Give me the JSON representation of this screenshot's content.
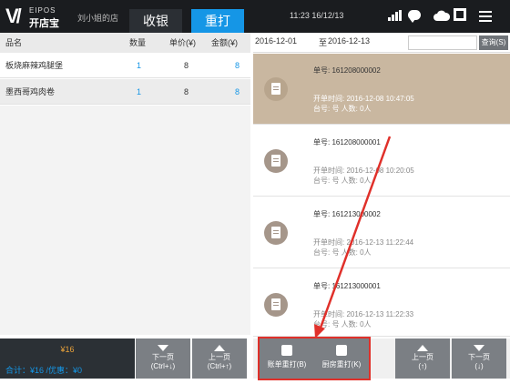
{
  "header": {
    "brand_top": "EIPOS",
    "brand_bottom": "开店宝",
    "shop_name": "刘小姐的店",
    "tabs": [
      {
        "label": "收银"
      },
      {
        "label": "重打"
      }
    ],
    "status_text": "11:23  16/12/13"
  },
  "order_table": {
    "columns": [
      "品名",
      "数量",
      "单价(¥)",
      "金额(¥)"
    ],
    "rows": [
      {
        "name": "板烧麻辣鸡腿堡",
        "qty": "1",
        "price": "8",
        "amount": "8"
      },
      {
        "name": "墨西哥鸡肉卷",
        "qty": "1",
        "price": "8",
        "amount": "8"
      }
    ]
  },
  "totals": {
    "amount": "¥16",
    "line": "合计：¥16   /优惠：¥0"
  },
  "left_pager": {
    "next_label": "下一页",
    "next_shortcut": "(Ctrl+↓)",
    "prev_label": "上一页",
    "prev_shortcut": "(Ctrl+↑)"
  },
  "search": {
    "start_date": "2016-12-01",
    "separator": "至",
    "end_date": "2016-12-13",
    "query_label": "查询(S)"
  },
  "orders": [
    {
      "number": "单号: 161208000002",
      "open_time": "开单时间: 2016-12-08  10:47:05",
      "table": "台号: 号  人数: 0人",
      "selected": true
    },
    {
      "number": "单号: 161208000001",
      "open_time": "开单时间: 2016-12-08  10:20:05",
      "table": "台号: 号  人数: 0人",
      "selected": false
    },
    {
      "number": "单号: 161213000002",
      "open_time": "开单时间: 2016-12-13  11:22:44",
      "table": "台号: 号  人数: 0人",
      "selected": false
    },
    {
      "number": "单号: 161213000001",
      "open_time": "开单时间: 2016-12-13  11:22:33",
      "table": "台号: 号  人数: 0人",
      "selected": false
    }
  ],
  "actions": {
    "bill_reprint": "账单重打(B)",
    "kitchen_reprint": "厨房重打(K)"
  },
  "right_pager": {
    "prev_label": "上一页",
    "prev_shortcut": "(↑)",
    "next_label": "下一页",
    "next_shortcut": "(↓)"
  },
  "colors": {
    "accent": "#1596e6",
    "selected_card": "#c9b7a0",
    "highlight": "#e0302a",
    "total_amount": "#e8a13a"
  }
}
